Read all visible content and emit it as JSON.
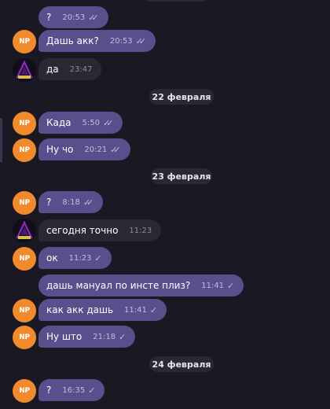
{
  "messages": [
    {
      "text": "?",
      "time": "20:53",
      "status": "read"
    },
    {
      "text": "Дашь акк?",
      "time": "20:53",
      "status": "read"
    },
    {
      "text": "да",
      "time": "23:47"
    },
    {
      "date": "22 февраля"
    },
    {
      "text": "Када",
      "time": "5:50",
      "status": "read"
    },
    {
      "text": "Ну чо",
      "time": "20:21",
      "status": "read"
    },
    {
      "date": "23 февраля"
    },
    {
      "text": "?",
      "time": "8:18",
      "status": "read"
    },
    {
      "text": "сегодня точно",
      "time": "11:23"
    },
    {
      "text": "ок",
      "time": "11:23",
      "status": "sent"
    },
    {
      "text": "дашь мануал по инсте плиз?",
      "time": "11:41",
      "status": "sent"
    },
    {
      "text": "как акк дашь",
      "time": "11:41",
      "status": "sent"
    },
    {
      "text": "Ну што",
      "time": "21:18",
      "status": "sent"
    },
    {
      "date": "24 февраля"
    },
    {
      "text": "?",
      "time": "16:35",
      "status": "sent"
    }
  ],
  "icons": {
    "read": "double-check-icon",
    "sent": "single-check-icon"
  },
  "avatar_np": "NP",
  "colors": {
    "background": "#1a1822",
    "outgoing_bubble": "#5b4e8c",
    "incoming_bubble": "#2a2833",
    "avatar_orange": "#f08a2c"
  }
}
